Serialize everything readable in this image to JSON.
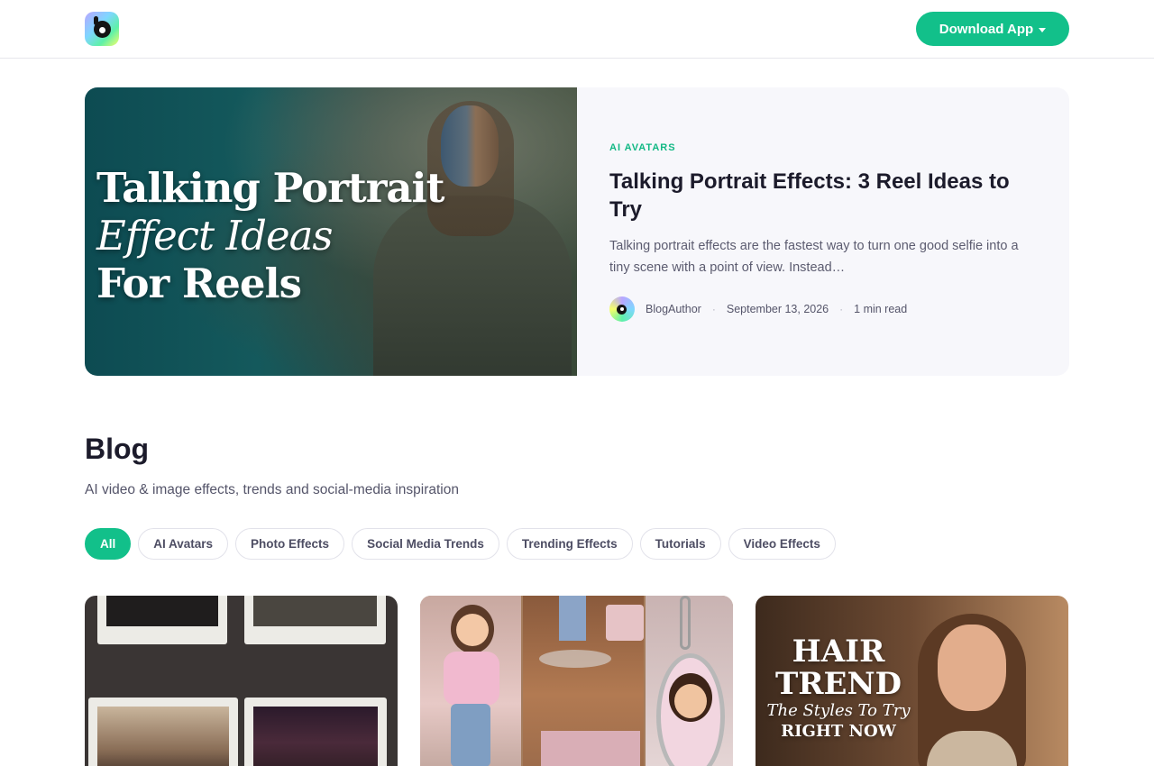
{
  "header": {
    "logo_name": "app-logo",
    "download_label": "Download App"
  },
  "featured": {
    "image_title_line1": "Talking Portrait",
    "image_title_line2": "Effect Ideas",
    "image_title_line3": "For Reels",
    "category": "AI AVATARS",
    "title": "Talking Portrait Effects: 3 Reel Ideas to Try",
    "excerpt": "Talking portrait effects are the fastest way to turn one good selfie into a tiny scene with a point of view. Instead…",
    "author": "BlogAuthor",
    "date": "September 13, 2026",
    "read_time": "1 min read"
  },
  "blog": {
    "title": "Blog",
    "subtitle": "AI video & image effects, trends and social-media inspiration"
  },
  "filters": [
    "All",
    "AI Avatars",
    "Photo Effects",
    "Social Media Trends",
    "Trending Effects",
    "Tutorials",
    "Video Effects"
  ],
  "active_filter": "All",
  "cards": {
    "card3_line1": "HAIR",
    "card3_line2": "TREND",
    "card3_line3": "The Styles To Try",
    "card3_line4": "RIGHT NOW"
  },
  "colors": {
    "accent": "#12c08a",
    "text_dark": "#1c1b2b",
    "text_muted": "#55556a"
  }
}
